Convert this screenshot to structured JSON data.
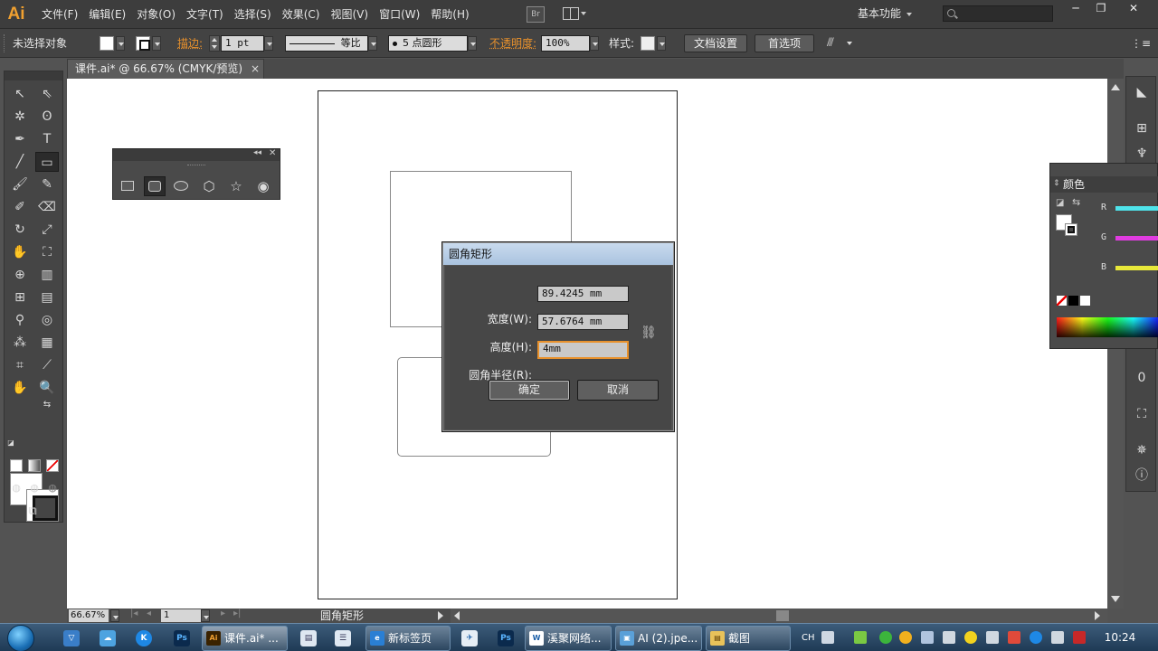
{
  "app": {
    "logo": "Ai",
    "menu": [
      "文件(F)",
      "编辑(E)",
      "对象(O)",
      "文字(T)",
      "选择(S)",
      "效果(C)",
      "视图(V)",
      "窗口(W)",
      "帮助(H)"
    ],
    "bridge_label": "Br",
    "workspace": "基本功能",
    "search_placeholder": "",
    "window_controls": [
      "─",
      "❐",
      "✕"
    ]
  },
  "control_bar": {
    "selection": "未选择对象",
    "stroke_label": "描边:",
    "stroke_weight": "1 pt",
    "stroke_profile": "等比",
    "brush": "5 点圆形",
    "opacity_label": "不透明度:",
    "opacity_value": "100%",
    "style_label": "样式:",
    "doc_setup_btn": "文档设置",
    "prefs_btn": "首选项"
  },
  "document_tab": {
    "title": "课件.ai* @ 66.67% (CMYK/预览)",
    "close": "×"
  },
  "dialog": {
    "title": "圆角矩形",
    "width_label": "宽度(W):",
    "width_value": "89.4245 mm",
    "height_label": "高度(H):",
    "height_value": "57.6764 mm",
    "radius_label": "圆角半径(R):",
    "radius_value": "4mm",
    "ok": "确定",
    "cancel": "取消"
  },
  "color_panel": {
    "title": "颜色",
    "channels": [
      {
        "label": "R",
        "color": "#4fe3ea"
      },
      {
        "label": "G",
        "color": "#e03ce0"
      },
      {
        "label": "B",
        "color": "#e8e83a"
      }
    ]
  },
  "status": {
    "zoom": "66.67%",
    "page": "1",
    "tool_name": "圆角矩形"
  },
  "taskbar": {
    "tasks": [
      {
        "label": "课件.ai* ...",
        "icon": "Ai",
        "icon_color": "#3a2200",
        "icon_text_color": "#f0a030",
        "active": true
      },
      {
        "label": "新标签页",
        "icon": "e",
        "icon_color": "#2a7fd4",
        "icon_text_color": "#ffffff",
        "active": false
      },
      {
        "label": "溪聚网络...",
        "icon": "W",
        "icon_color": "#ffffff",
        "icon_text_color": "#1b5fa8",
        "active": false
      },
      {
        "label": "AI (2).jpe...",
        "icon": "▣",
        "icon_color": "#5aa0d8",
        "icon_text_color": "#ffffff",
        "active": false
      },
      {
        "label": "截图",
        "icon": "▤",
        "icon_color": "#e8c25a",
        "icon_text_color": "#5a3a00",
        "active": false
      }
    ],
    "lang": "CH",
    "clock": "10:24"
  }
}
